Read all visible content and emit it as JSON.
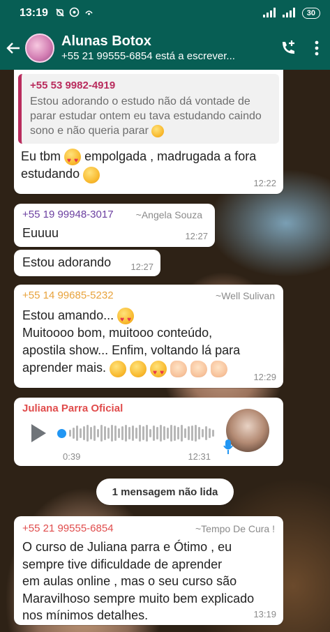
{
  "status_bar": {
    "time": "13:19",
    "battery": "30"
  },
  "chat": {
    "title": "Alunas Botox",
    "subtitle": "+55 21 99555-6854 está a escrever..."
  },
  "messages": [
    {
      "quote_sender": "+55 53 9982-4919",
      "quote_text": "Estou adorando o estudo não dá vontade de parar estudar ontem eu tava estudando caindo sono e não queria parar",
      "line1_a": "Eu tbm",
      "line1_b": "empolgada , madrugada a fora",
      "line2": "estudando",
      "time": "12:22"
    },
    {
      "sender": "+55 19 99948-3017",
      "alias": "~Angela Souza",
      "text": "Euuuu",
      "time": "12:27"
    },
    {
      "text": "Estou adorando",
      "time": "12:27"
    },
    {
      "sender": "+55 14 99685-5232",
      "alias": "~Well Sulivan",
      "line1": "Estou amando...",
      "line2": "Muitoooo bom, muitooo conteúdo,",
      "line3": "apostila show... Enfim, voltando lá para",
      "line4": "aprender mais.",
      "time": "12:29"
    },
    {
      "sender": "Juliana Parra Oficial",
      "duration": "0:39",
      "time": "12:31"
    },
    {
      "sender": "+55 21 99555-6854",
      "alias": "~Tempo De Cura !",
      "line1": "O curso de Juliana parra e Ótimo , eu",
      "line2": "sempre tive dificuldade de aprender",
      "line3": "em aulas online , mas o seu curso são",
      "line4": "Maravilhoso sempre muito bem explicado",
      "line5": "nos mínimos detalhes.",
      "time": "13:19"
    }
  ],
  "unread_label": "1 mensagem não lida",
  "colors": {
    "header": "#075e54",
    "quote_accent": "#b92c5d",
    "sender_purple": "#6b3fa0",
    "sender_orange": "#e8a33c",
    "sender_red": "#e04c4c",
    "audio_blue": "#2196f3"
  }
}
